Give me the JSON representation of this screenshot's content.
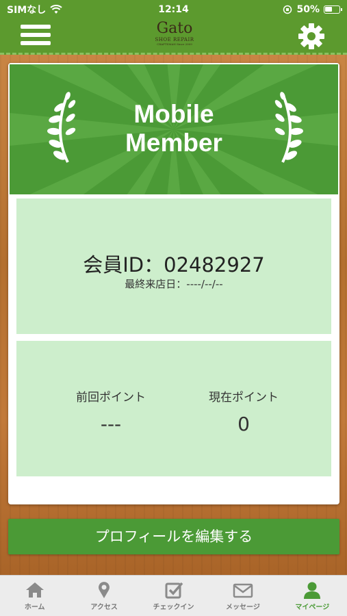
{
  "status_bar": {
    "carrier": "SIMなし",
    "time": "12:14",
    "battery": "50%"
  },
  "header": {
    "logo_main": "Gato",
    "logo_sub": "SHOE REPAIR",
    "logo_tiny": "CRAFTSMAN Since 2009"
  },
  "banner": {
    "title_line1": "Mobile",
    "title_line2": "Member"
  },
  "member": {
    "id_text": "会員ID：02482927",
    "last_visit": "最終来店日：----/--/--"
  },
  "points": {
    "previous_label": "前回ポイント",
    "previous_value": "---",
    "current_label": "現在ポイント",
    "current_value": "0"
  },
  "edit_button": "プロフィールを編集する",
  "tabs": [
    {
      "label": "ホーム",
      "icon": "home-icon"
    },
    {
      "label": "アクセス",
      "icon": "map-pin-icon"
    },
    {
      "label": "チェックイン",
      "icon": "checkin-icon"
    },
    {
      "label": "メッセージ",
      "icon": "mail-icon"
    },
    {
      "label": "マイページ",
      "icon": "person-icon"
    }
  ],
  "colors": {
    "brand_green": "#4b9a36",
    "header_green": "#5c9a2e",
    "panel_green": "#cdeecc",
    "wood": "#b9743b"
  }
}
